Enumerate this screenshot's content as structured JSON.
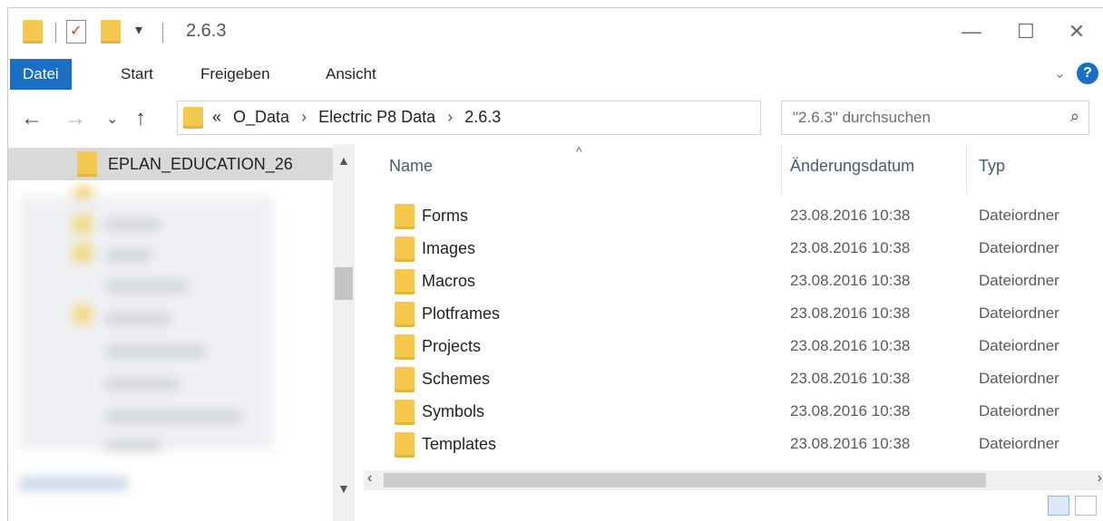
{
  "window": {
    "title": "2.6.3"
  },
  "ribbon": {
    "tabs": [
      {
        "label": "Datei"
      },
      {
        "label": "Start"
      },
      {
        "label": "Freigeben"
      },
      {
        "label": "Ansicht"
      }
    ],
    "help_label": "?"
  },
  "address": {
    "crumbs": [
      "O_Data",
      "Electric P8 Data",
      "2.6.3"
    ],
    "overflow_label": "«"
  },
  "search": {
    "placeholder": "\"2.6.3\" durchsuchen"
  },
  "nav": {
    "selected_label": "EPLAN_EDUCATION_26"
  },
  "columns": {
    "name": "Name",
    "date": "Änderungsdatum",
    "type": "Typ"
  },
  "files": [
    {
      "name": "Forms",
      "date": "23.08.2016 10:38",
      "type": "Dateiordner"
    },
    {
      "name": "Images",
      "date": "23.08.2016 10:38",
      "type": "Dateiordner"
    },
    {
      "name": "Macros",
      "date": "23.08.2016 10:38",
      "type": "Dateiordner"
    },
    {
      "name": "Plotframes",
      "date": "23.08.2016 10:38",
      "type": "Dateiordner"
    },
    {
      "name": "Projects",
      "date": "23.08.2016 10:38",
      "type": "Dateiordner"
    },
    {
      "name": "Schemes",
      "date": "23.08.2016 10:38",
      "type": "Dateiordner"
    },
    {
      "name": "Symbols",
      "date": "23.08.2016 10:38",
      "type": "Dateiordner"
    },
    {
      "name": "Templates",
      "date": "23.08.2016 10:38",
      "type": "Dateiordner"
    }
  ],
  "colors": {
    "accent": "#1a6fc4",
    "folder": "#f5c94f",
    "selection": "#d9d9d9"
  }
}
